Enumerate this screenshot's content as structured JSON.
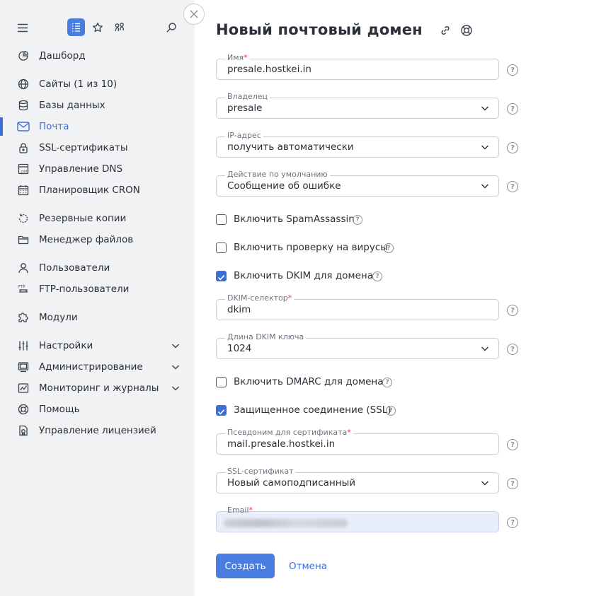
{
  "sidebar": {
    "items": [
      {
        "label": "Дашборд",
        "icon": "dashboard-icon"
      },
      {
        "label": "Сайты (1 из 10)",
        "icon": "globe-icon"
      },
      {
        "label": "Базы данных",
        "icon": "database-icon"
      },
      {
        "label": "Почта",
        "icon": "mail-icon",
        "active": true
      },
      {
        "label": "SSL-сертификаты",
        "icon": "lock-icon"
      },
      {
        "label": "Управление DNS",
        "icon": "dns-icon"
      },
      {
        "label": "Планировщик CRON",
        "icon": "calendar-icon"
      },
      {
        "label": "Резервные копии",
        "icon": "backup-icon"
      },
      {
        "label": "Менеджер файлов",
        "icon": "folder-icon"
      },
      {
        "label": "Пользователи",
        "icon": "user-icon"
      },
      {
        "label": "FTP-пользователи",
        "icon": "ftp-icon"
      },
      {
        "label": "Модули",
        "icon": "puzzle-icon"
      },
      {
        "label": "Настройки",
        "icon": "sliders-icon",
        "expandable": true
      },
      {
        "label": "Администрирование",
        "icon": "server-icon",
        "expandable": true
      },
      {
        "label": "Мониторинг и журналы",
        "icon": "chart-icon",
        "expandable": true
      },
      {
        "label": "Помощь",
        "icon": "lifebuoy-icon"
      },
      {
        "label": "Управление лицензией",
        "icon": "license-icon"
      }
    ]
  },
  "main": {
    "title": "Новый почтовый домен",
    "fields": {
      "name": {
        "label": "Имя",
        "value": "presale.hostkei.in"
      },
      "owner": {
        "label": "Владелец",
        "value": "presale"
      },
      "ip": {
        "label": "IP-адрес",
        "value": "получить автоматически"
      },
      "default_action": {
        "label": "Действие по умолчанию",
        "value": "Сообщение об ошибке"
      },
      "dkim_selector": {
        "label": "DKIM-селектор",
        "value": "dkim"
      },
      "dkim_length": {
        "label": "Длина DKIM ключа",
        "value": "1024"
      },
      "cert_alias": {
        "label": "Псевдоним для сертификата",
        "value": "mail.presale.hostkei.in"
      },
      "ssl_cert": {
        "label": "SSL-сертификат",
        "value": "Новый самоподписанный"
      },
      "email": {
        "label": "Email"
      }
    },
    "checkboxes": {
      "spamassassin": {
        "label": "Включить SpamAssassin",
        "checked": false
      },
      "antivirus": {
        "label": "Включить проверку на вирусы",
        "checked": false
      },
      "dkim": {
        "label": "Включить DKIM для домена",
        "checked": true
      },
      "dmarc": {
        "label": "Включить DMARC для домена",
        "checked": false
      },
      "ssl": {
        "label": "Защищенное соединение (SSL)",
        "checked": true
      }
    },
    "actions": {
      "create": "Создать",
      "cancel": "Отмена"
    }
  },
  "colors": {
    "accent": "#4a7de0",
    "required": "#e0354b",
    "sidebar_bg": "#f1f2f4"
  }
}
